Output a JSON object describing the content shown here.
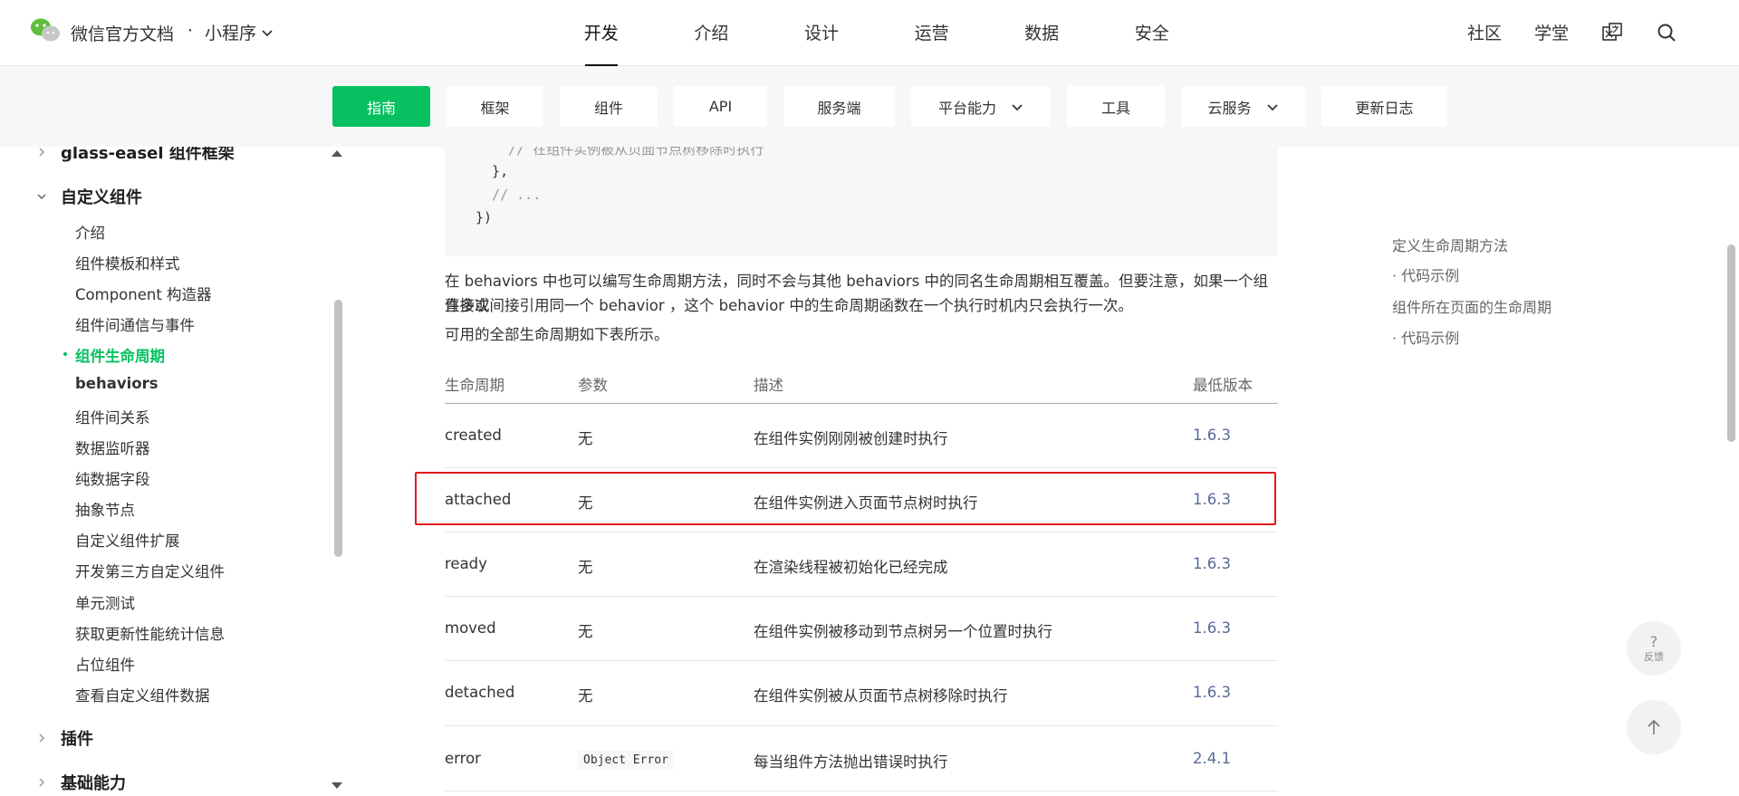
{
  "header": {
    "brand": "微信官方文档",
    "separator": "·",
    "product": "小程序",
    "nav": [
      "开发",
      "介绍",
      "设计",
      "运营",
      "数据",
      "安全"
    ],
    "nav_active": "开发",
    "right_links": [
      "社区",
      "学堂"
    ],
    "icons": [
      "translate-icon",
      "search-icon"
    ]
  },
  "subnav": {
    "tabs": [
      {
        "label": "指南",
        "active": true,
        "dropdown": false
      },
      {
        "label": "框架",
        "active": false,
        "dropdown": false
      },
      {
        "label": "组件",
        "active": false,
        "dropdown": false
      },
      {
        "label": "API",
        "active": false,
        "dropdown": false
      },
      {
        "label": "服务端",
        "active": false,
        "dropdown": false
      },
      {
        "label": "平台能力",
        "active": false,
        "dropdown": true
      },
      {
        "label": "工具",
        "active": false,
        "dropdown": false
      },
      {
        "label": "云服务",
        "active": false,
        "dropdown": true
      },
      {
        "label": "更新日志",
        "active": false,
        "dropdown": false
      }
    ]
  },
  "sidebar": {
    "top_partial": "glass-easel 组件框架",
    "category": "自定义组件",
    "items": [
      {
        "label": "介绍",
        "state": "normal"
      },
      {
        "label": "组件模板和样式",
        "state": "normal"
      },
      {
        "label": "Component 构造器",
        "state": "normal"
      },
      {
        "label": "组件间通信与事件",
        "state": "normal"
      },
      {
        "label": "组件生命周期",
        "state": "active"
      },
      {
        "label": "behaviors",
        "state": "bold"
      },
      {
        "label": "组件间关系",
        "state": "normal"
      },
      {
        "label": "数据监听器",
        "state": "normal"
      },
      {
        "label": "纯数据字段",
        "state": "normal"
      },
      {
        "label": "抽象节点",
        "state": "normal"
      },
      {
        "label": "自定义组件扩展",
        "state": "normal"
      },
      {
        "label": "开发第三方自定义组件",
        "state": "normal"
      },
      {
        "label": "单元测试",
        "state": "normal"
      },
      {
        "label": "获取更新性能统计信息",
        "state": "normal"
      },
      {
        "label": "占位组件",
        "state": "normal"
      },
      {
        "label": "查看自定义组件数据",
        "state": "normal"
      }
    ],
    "after_categories": [
      "插件",
      "基础能力"
    ]
  },
  "content": {
    "code_lines": [
      {
        "text": "    // 在组件实例被从页面节点树移除时执行",
        "comment": true
      },
      {
        "text": "  },",
        "comment": false
      },
      {
        "text": "  // ...",
        "comment": true
      },
      {
        "text": "})",
        "comment": false
      }
    ],
    "para1_line1": "在 behaviors 中也可以编写生命周期方法，同时不会与其他 behaviors 中的同名生命周期相互覆盖。但要注意，如果一个组件多次",
    "para1_line2": "直接或间接引用同一个 behavior ，这个 behavior 中的生命周期函数在一个执行时机内只会执行一次。",
    "para2": "可用的全部生命周期如下表所示。",
    "table": {
      "headers": [
        "生命周期",
        "参数",
        "描述",
        "最低版本"
      ],
      "rows": [
        {
          "name": "created",
          "param": "无",
          "desc": "在组件实例刚刚被创建时执行",
          "version": "1.6.3",
          "param_code": false
        },
        {
          "name": "attached",
          "param": "无",
          "desc": "在组件实例进入页面节点树时执行",
          "version": "1.6.3",
          "param_code": false
        },
        {
          "name": "ready",
          "param": "无",
          "desc": "在渲染线程被初始化已经完成",
          "version": "1.6.3",
          "param_code": false
        },
        {
          "name": "moved",
          "param": "无",
          "desc": "在组件实例被移动到节点树另一个位置时执行",
          "version": "1.6.3",
          "param_code": false
        },
        {
          "name": "detached",
          "param": "无",
          "desc": "在组件实例被从页面节点树移除时执行",
          "version": "1.6.3",
          "param_code": false
        },
        {
          "name": "error",
          "param": "Object Error",
          "desc": "每当组件方法抛出错误时执行",
          "version": "2.4.1",
          "param_code": true
        }
      ]
    }
  },
  "toc": [
    {
      "label": "定义生命周期方法",
      "sub": false
    },
    {
      "label": "· 代码示例",
      "sub": true
    },
    {
      "label": "组件所在页面的生命周期",
      "sub": false
    },
    {
      "label": "· 代码示例",
      "sub": true
    }
  ],
  "floating": {
    "feedback_glyph": "?",
    "feedback_label": "反馈",
    "back_to_top_glyph": "↑"
  },
  "colors": {
    "accent": "#07c160",
    "link": "#576b95",
    "highlight_box": "#e01b1b"
  }
}
